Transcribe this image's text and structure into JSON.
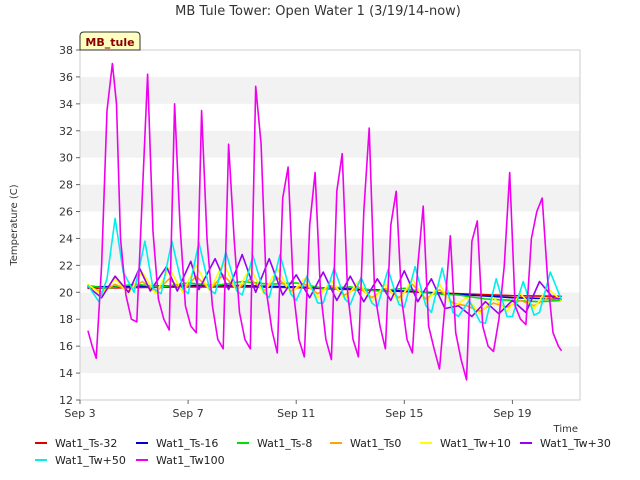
{
  "chart_data": {
    "type": "line",
    "title": "MB Tule Tower: Open Water 1 (3/19/14-now)",
    "badge": "MB_tule",
    "xlabel": "Time",
    "ylabel": "Temperature (C)",
    "xlim": [
      3,
      21.5
    ],
    "ylim": [
      12,
      38
    ],
    "x_ticks": [
      3,
      7,
      11,
      15,
      19
    ],
    "x_tick_labels": [
      "Sep 3",
      "Sep 7",
      "Sep 11",
      "Sep 15",
      "Sep 19"
    ],
    "y_ticks": [
      12,
      14,
      16,
      18,
      20,
      22,
      24,
      26,
      28,
      30,
      32,
      34,
      36,
      38
    ],
    "grid": "horizontal bands",
    "legend_position": "bottom",
    "series": [
      {
        "name": "Wat1_Ts-32",
        "color": "#dd0000",
        "x": [
          3.3,
          5,
          7,
          9,
          11,
          13,
          15,
          17,
          19,
          20.8
        ],
        "y": [
          20.3,
          20.35,
          20.4,
          20.4,
          20.35,
          20.2,
          20.05,
          19.9,
          19.75,
          19.7
        ]
      },
      {
        "name": "Wat1_Ts-16",
        "color": "#0000cc",
        "x": [
          3.3,
          5,
          7,
          9,
          11,
          13,
          15,
          17,
          19,
          20.8
        ],
        "y": [
          20.4,
          20.45,
          20.5,
          20.5,
          20.4,
          20.25,
          20.1,
          19.85,
          19.6,
          19.5
        ]
      },
      {
        "name": "Wat1_Ts-8",
        "color": "#00dd00",
        "x": [
          3.3,
          4,
          5,
          6,
          7,
          8,
          9,
          10,
          11,
          12,
          13,
          14,
          15,
          16,
          17,
          18,
          19,
          20,
          20.8
        ],
        "y": [
          20.5,
          20.3,
          20.6,
          20.4,
          20.7,
          20.5,
          20.8,
          20.6,
          20.7,
          20.3,
          20.4,
          20.1,
          20.3,
          19.9,
          19.8,
          19.5,
          19.4,
          19.3,
          19.4
        ]
      },
      {
        "name": "Wat1_Ts0",
        "color": "#ffa500",
        "x": [
          3.3,
          3.8,
          4.3,
          4.8,
          5.3,
          5.8,
          6.3,
          6.8,
          7.3,
          7.8,
          8.3,
          8.8,
          9.3,
          9.8,
          10.3,
          10.8,
          11.3,
          11.8,
          12.3,
          12.8,
          13.3,
          13.8,
          14.3,
          14.8,
          15.3,
          15.8,
          16.3,
          16.8,
          17.3,
          17.8,
          18.3,
          18.8,
          19.3,
          19.8,
          20.3,
          20.8
        ],
        "y": [
          20.5,
          20.0,
          20.6,
          20.1,
          20.8,
          20.0,
          21.0,
          20.1,
          21.2,
          20.2,
          21.3,
          20.2,
          21.0,
          20.1,
          21.1,
          20.1,
          20.6,
          19.9,
          20.5,
          19.8,
          20.4,
          19.6,
          20.3,
          19.6,
          20.6,
          19.5,
          20.2,
          19.2,
          19.0,
          18.6,
          19.2,
          18.9,
          19.4,
          19.0,
          19.6,
          19.5
        ]
      },
      {
        "name": "Wat1_Tw+10",
        "color": "#ffff00",
        "x": [
          3.3,
          3.8,
          4.3,
          4.8,
          5.3,
          5.8,
          6.3,
          6.8,
          7.3,
          7.8,
          8.3,
          8.8,
          9.3,
          9.8,
          10.3,
          10.8,
          11.3,
          11.8,
          12.3,
          12.8,
          13.3,
          13.8,
          14.3,
          14.8,
          15.3,
          15.8,
          16.3,
          16.8,
          17.3,
          17.8,
          18.3,
          18.8,
          19.3,
          19.8,
          20.3,
          20.8
        ],
        "y": [
          20.6,
          19.8,
          21.0,
          19.9,
          21.5,
          19.9,
          21.8,
          20.0,
          22.0,
          20.1,
          22.2,
          20.1,
          21.8,
          19.9,
          21.8,
          19.9,
          21.0,
          19.6,
          20.9,
          19.5,
          20.8,
          19.3,
          20.6,
          19.3,
          21.0,
          19.2,
          20.6,
          18.9,
          19.6,
          18.4,
          19.6,
          18.6,
          19.9,
          18.8,
          20.3,
          19.4
        ]
      },
      {
        "name": "Wat1_Tw+30",
        "color": "#9900ee",
        "x": [
          3.3,
          3.8,
          4.3,
          4.8,
          5.2,
          5.6,
          6.2,
          6.6,
          7.1,
          7.4,
          8.0,
          8.5,
          9.0,
          9.5,
          10.0,
          10.5,
          11.0,
          11.5,
          12.0,
          12.5,
          13.0,
          13.5,
          14.0,
          14.5,
          15.0,
          15.5,
          16.0,
          16.5,
          17.0,
          17.5,
          18.0,
          18.5,
          19.0,
          19.5,
          20.0,
          20.5,
          20.8
        ],
        "y": [
          20.4,
          19.6,
          21.2,
          20.0,
          21.8,
          20.1,
          21.9,
          20.1,
          22.3,
          20.2,
          22.5,
          20.2,
          22.8,
          20.0,
          22.5,
          19.8,
          21.3,
          19.6,
          21.5,
          19.4,
          21.2,
          19.3,
          21.0,
          19.4,
          21.6,
          19.3,
          21.0,
          18.8,
          19.0,
          18.2,
          19.3,
          18.4,
          19.4,
          18.5,
          20.8,
          19.6,
          19.5
        ]
      },
      {
        "name": "Wat1_Tw+50",
        "color": "#00eeee",
        "x": [
          3.3,
          3.7,
          4.0,
          4.3,
          4.6,
          5.0,
          5.4,
          5.7,
          6.0,
          6.4,
          6.8,
          7.0,
          7.4,
          7.8,
          8.0,
          8.4,
          8.8,
          9.0,
          9.4,
          9.8,
          10.0,
          10.4,
          10.8,
          11.0,
          11.4,
          11.8,
          12.0,
          12.4,
          12.8,
          13.0,
          13.4,
          13.8,
          14.0,
          14.4,
          14.8,
          15.0,
          15.4,
          15.8,
          16.0,
          16.4,
          16.8,
          17.0,
          17.4,
          17.8,
          18.0,
          18.4,
          18.8,
          19.0,
          19.4,
          19.8,
          20.0,
          20.4,
          20.8
        ],
        "y": [
          20.5,
          19.3,
          21.0,
          25.5,
          21.5,
          20.0,
          23.8,
          20.3,
          19.9,
          23.8,
          20.3,
          19.9,
          23.7,
          20.2,
          19.9,
          23.0,
          20.1,
          19.8,
          22.7,
          20.0,
          19.6,
          22.8,
          19.9,
          19.4,
          21.2,
          19.2,
          19.2,
          21.8,
          19.5,
          19.1,
          21.1,
          19.2,
          18.9,
          21.7,
          19.1,
          18.9,
          21.9,
          19.0,
          18.5,
          21.8,
          18.5,
          18.2,
          19.4,
          17.8,
          17.7,
          21.0,
          18.2,
          18.2,
          20.8,
          18.3,
          18.5,
          21.5,
          19.5
        ]
      },
      {
        "name": "Wat1_Tw100",
        "color": "#ee00ee",
        "x": [
          3.3,
          3.45,
          3.6,
          3.8,
          4.0,
          4.2,
          4.35,
          4.5,
          4.7,
          4.9,
          5.1,
          5.3,
          5.5,
          5.7,
          5.9,
          6.1,
          6.3,
          6.5,
          6.7,
          6.9,
          7.1,
          7.3,
          7.5,
          7.7,
          7.9,
          8.1,
          8.3,
          8.5,
          8.7,
          8.9,
          9.1,
          9.3,
          9.5,
          9.7,
          9.9,
          10.1,
          10.3,
          10.5,
          10.7,
          10.9,
          11.1,
          11.3,
          11.5,
          11.7,
          11.9,
          12.1,
          12.3,
          12.5,
          12.7,
          12.9,
          13.1,
          13.3,
          13.5,
          13.7,
          13.9,
          14.1,
          14.3,
          14.5,
          14.7,
          14.9,
          15.1,
          15.3,
          15.5,
          15.7,
          15.9,
          16.1,
          16.3,
          16.5,
          16.7,
          16.9,
          17.1,
          17.3,
          17.5,
          17.7,
          17.9,
          18.1,
          18.3,
          18.5,
          18.7,
          18.9,
          19.1,
          19.3,
          19.5,
          19.7,
          19.9,
          20.1,
          20.3,
          20.5,
          20.7,
          20.8
        ],
        "y": [
          17.1,
          16.0,
          15.1,
          22.0,
          33.5,
          37.0,
          34.0,
          24.0,
          19.8,
          18.0,
          17.8,
          27.0,
          36.2,
          24.5,
          19.5,
          18.0,
          17.2,
          34.0,
          25.0,
          19.0,
          17.5,
          17.0,
          33.5,
          24.0,
          19.0,
          16.5,
          15.8,
          31.0,
          24.0,
          18.5,
          16.5,
          15.8,
          35.3,
          31.0,
          20.0,
          17.2,
          15.5,
          27.0,
          29.3,
          20.0,
          16.5,
          15.2,
          25.0,
          28.9,
          20.0,
          16.5,
          15.0,
          27.5,
          30.3,
          20.0,
          16.5,
          15.2,
          26.0,
          32.2,
          20.0,
          17.5,
          15.8,
          25.0,
          27.5,
          19.5,
          16.5,
          15.5,
          22.0,
          26.4,
          17.5,
          15.8,
          14.3,
          19.0,
          24.2,
          17.0,
          15.0,
          13.5,
          23.8,
          25.3,
          17.5,
          16.0,
          15.6,
          18.0,
          22.0,
          28.9,
          19.0,
          18.0,
          17.6,
          24.0,
          26.0,
          27.0,
          21.0,
          17.0,
          16.0,
          15.7
        ]
      }
    ]
  }
}
